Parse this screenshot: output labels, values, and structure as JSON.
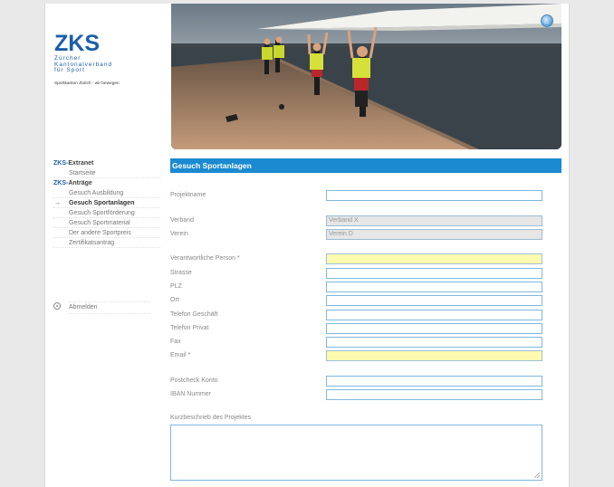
{
  "logo": {
    "abbr": "ZKS",
    "name_lines": [
      "Zürcher",
      "Kantonalverband",
      "für Sport"
    ],
    "claim": "Sportkanton Zürich - wir bewegen"
  },
  "nav": {
    "groups": [
      {
        "prefix": "ZKS-",
        "title": "Extranet",
        "items": [
          {
            "label": "Startseite",
            "active": false
          }
        ]
      },
      {
        "prefix": "ZKS-",
        "title": "Anträge",
        "items": [
          {
            "label": "Gesuch Ausbildung",
            "active": false
          },
          {
            "label": "Gesuch Sportanlagen",
            "active": true
          },
          {
            "label": "Gesuch Sportförderung",
            "active": false
          },
          {
            "label": "Gesuch Sportmaterial",
            "active": false
          },
          {
            "label": "Der andere Sportpreis",
            "active": false
          },
          {
            "label": "Zertifikatsantrag",
            "active": false
          }
        ]
      }
    ],
    "active_marker": "→",
    "logout": "Abmelden"
  },
  "page_title": "Gesuch Sportanlagen",
  "form": {
    "projektname": {
      "label": "Projektname",
      "value": ""
    },
    "verband": {
      "label": "Verband",
      "value": "Verband X"
    },
    "verein": {
      "label": "Verein",
      "value": "Verein D"
    },
    "verantwortliche_person": {
      "label": "Verantwortliche Person *",
      "value": ""
    },
    "strasse": {
      "label": "Strasse",
      "value": ""
    },
    "plz": {
      "label": "PLZ",
      "value": ""
    },
    "ort": {
      "label": "Ort",
      "value": ""
    },
    "telefon_geschaeft": {
      "label": "Telefon Geschäft",
      "value": ""
    },
    "telefon_privat": {
      "label": "Telefon Privat",
      "value": ""
    },
    "fax": {
      "label": "Fax",
      "value": ""
    },
    "email": {
      "label": "Email *",
      "value": ""
    },
    "postcheck_konto": {
      "label": "Postcheck Konto",
      "value": ""
    },
    "iban": {
      "label": "IBAN Nummer",
      "value": ""
    },
    "kurzbeschrieb": {
      "label": "Kurzbeschrieb des Projektes",
      "value": ""
    }
  },
  "colors": {
    "brand_blue": "#1a5fa8",
    "title_bar": "#1b8ad0",
    "required_field_bg": "#fdfbb0",
    "readonly_field_bg": "#e6e6e6"
  },
  "icons": {
    "home": "home-icon",
    "logout": "logout-circle-icon",
    "active_item": "arrow-right-icon"
  }
}
